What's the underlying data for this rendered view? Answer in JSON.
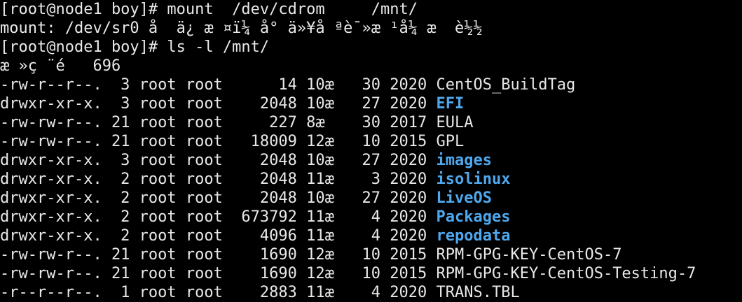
{
  "terminal": {
    "lines": [
      "[root@node1 boy]# mount  /dev/cdrom     /mnt/",
      "mount: /dev/sr0 å  ä¿ æ ¤ï¼ å° ä»¥å ªè¯»æ ¹å¼ æ  è½½",
      "[root@node1 boy]# ls -l /mnt/",
      "æ »ç ¨é   696"
    ],
    "colors": {
      "text": "#e8e8e8",
      "directory": "#4fa8ee",
      "background": "#000000"
    },
    "listing": [
      {
        "meta": "-rw-r--r--.  3 root root      14 10æ   30 2020 ",
        "name": "CentOS_BuildTag",
        "is_dir": false
      },
      {
        "meta": "drwxr-xr-x.  3 root root    2048 10æ   27 2020 ",
        "name": "EFI",
        "is_dir": true
      },
      {
        "meta": "-rw-rw-r--. 21 root root     227 8æ    30 2017 ",
        "name": "EULA",
        "is_dir": false
      },
      {
        "meta": "-rw-rw-r--. 21 root root   18009 12æ   10 2015 ",
        "name": "GPL",
        "is_dir": false
      },
      {
        "meta": "drwxr-xr-x.  3 root root    2048 10æ   27 2020 ",
        "name": "images",
        "is_dir": true
      },
      {
        "meta": "drwxr-xr-x.  2 root root    2048 11æ    3 2020 ",
        "name": "isolinux",
        "is_dir": true
      },
      {
        "meta": "drwxr-xr-x.  2 root root    2048 10æ   27 2020 ",
        "name": "LiveOS",
        "is_dir": true
      },
      {
        "meta": "drwxr-xr-x.  2 root root  673792 11æ    4 2020 ",
        "name": "Packages",
        "is_dir": true
      },
      {
        "meta": "drwxr-xr-x.  2 root root    4096 11æ    4 2020 ",
        "name": "repodata",
        "is_dir": true
      },
      {
        "meta": "-rw-rw-r--. 21 root root    1690 12æ   10 2015 ",
        "name": "RPM-GPG-KEY-CentOS-7",
        "is_dir": false
      },
      {
        "meta": "-rw-rw-r--. 21 root root    1690 12æ   10 2015 ",
        "name": "RPM-GPG-KEY-CentOS-Testing-7",
        "is_dir": false
      },
      {
        "meta": "-r--r--r--.  1 root root    2883 11æ    4 2020 ",
        "name": "TRANS.TBL",
        "is_dir": false
      }
    ]
  }
}
